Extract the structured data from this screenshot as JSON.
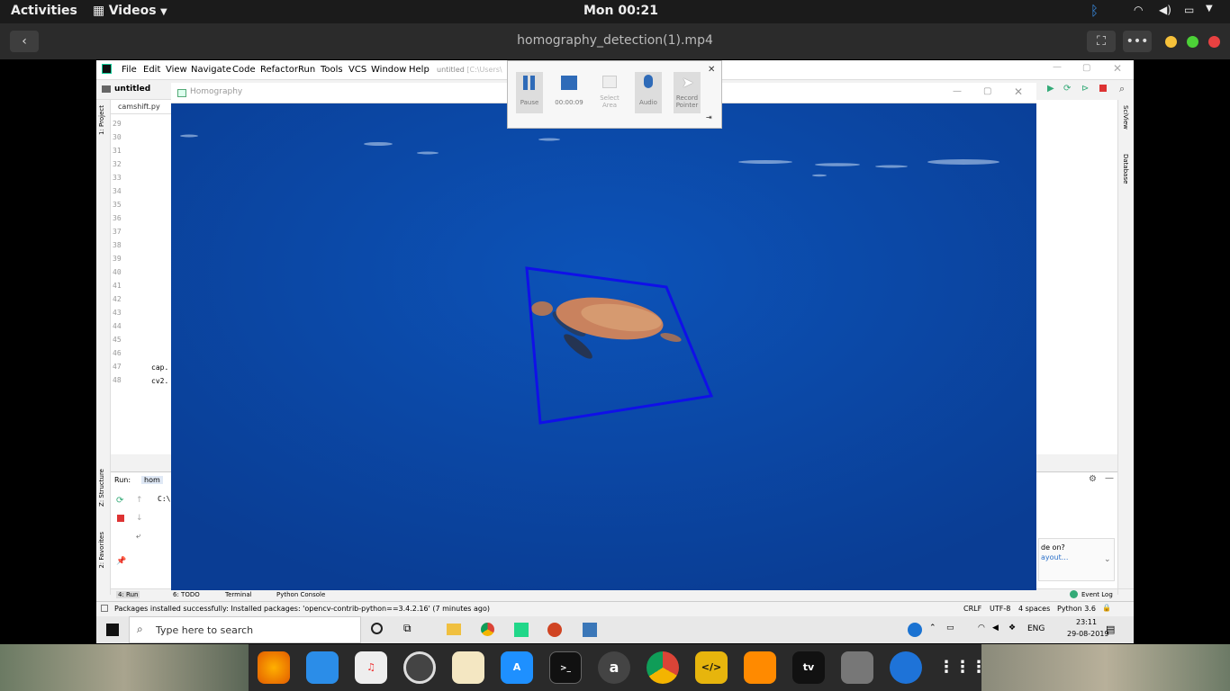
{
  "topbar": {
    "activities": "Activities",
    "app_menu": "Videos",
    "clock": "Mon 00:21"
  },
  "player": {
    "title": "homography_detection(1).mp4"
  },
  "ide": {
    "menu": [
      "File",
      "Edit",
      "View",
      "Navigate",
      "Code",
      "Refactor",
      "Run",
      "Tools",
      "VCS",
      "Window",
      "Help"
    ],
    "project_title": "untitled",
    "project_path": "[C:\\Users\\",
    "breadcrumb": "untitled",
    "file_tab": "camshift.py",
    "line_numbers": [
      "29",
      "30",
      "31",
      "32",
      "33",
      "34",
      "35",
      "36",
      "37",
      "38",
      "39",
      "40",
      "41",
      "42",
      "43",
      "44",
      "45",
      "46",
      "47",
      "48"
    ],
    "code_line_47": "cap.",
    "code_line_48": "cv2.",
    "side_project": "1: Project",
    "side_structure": "Z: Structure",
    "side_favorites": "2: Favorites",
    "right_sciview": "SciView",
    "right_database": "Database",
    "run_label": "Run:",
    "run_tab": "hom",
    "run_output": "C:\\",
    "notif_line1": "de on?",
    "notif_line2": "ayout...",
    "bottom_tabs": [
      "4: Run",
      "6: TODO",
      "Terminal",
      "Python Console"
    ],
    "event_log": "Event Log",
    "status_message": "Packages installed successfully: Installed packages: 'opencv-contrib-python==3.4.2.16' (7 minutes ago)",
    "status_right": [
      "CRLF",
      "UTF-8",
      "4 spaces",
      "Python 3.6"
    ]
  },
  "homography": {
    "title": "Homography"
  },
  "recorder": {
    "pause": "Pause",
    "timer": "00:00:09",
    "select_area": "Select Area",
    "audio": "Audio",
    "record_pointer": "Record Pointer"
  },
  "taskbar": {
    "search_placeholder": "Type here to search",
    "lang": "ENG",
    "time": "23:11",
    "date": "29-08-2019"
  },
  "dock": {
    "appletv": "tv"
  },
  "colors": {
    "tracking_box": "#1010e8",
    "ocean": "#0a46a4",
    "ide_bg": "#f2f2f2"
  }
}
